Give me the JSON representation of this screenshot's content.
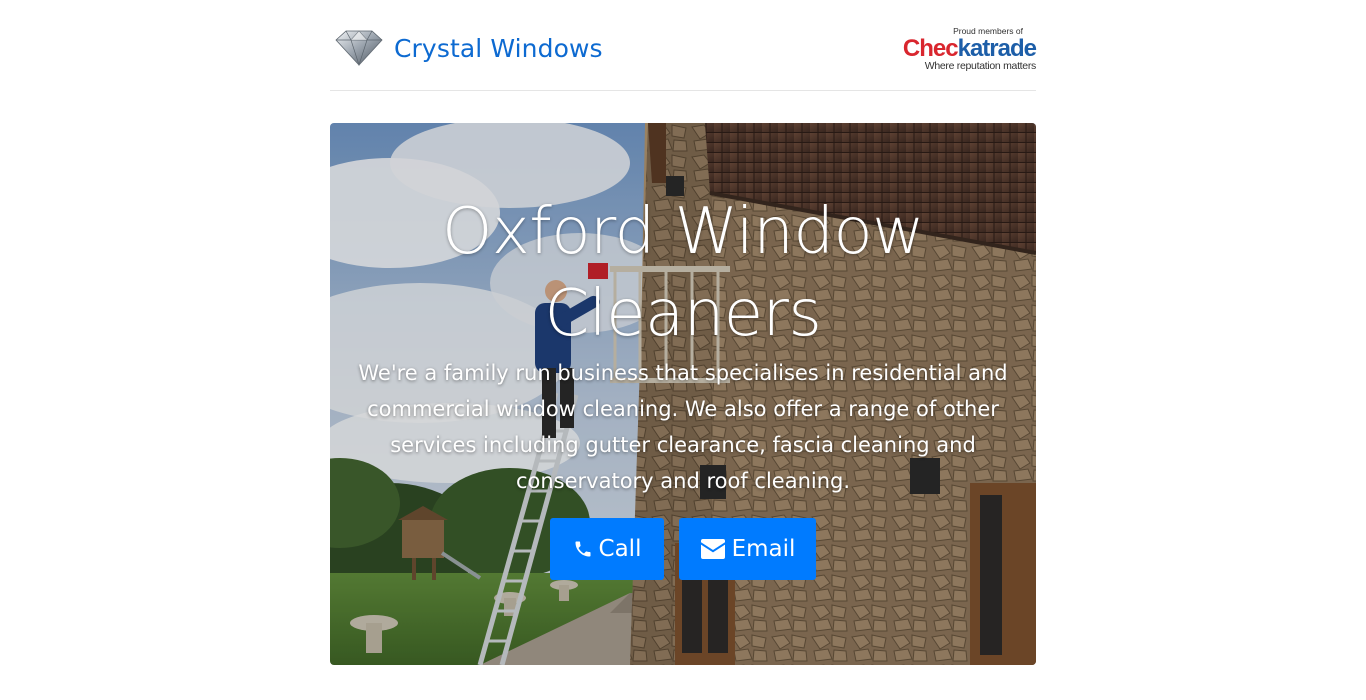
{
  "header": {
    "brand_name": "Crystal Windows",
    "logo_icon": "diamond-icon",
    "checkatrade": {
      "proud": "Proud members of",
      "wordmark_red": "Chec",
      "wordmark_tick": "k",
      "wordmark_blue": "atrade",
      "tagline": "Where reputation matters"
    }
  },
  "hero": {
    "title": "Oxford Window Cleaners",
    "lead": "We're a family run business that specialises in residential and commercial window cleaning. We also offer a range of other services including gutter clearance, fascia cleaning and conservatory and roof cleaning.",
    "buttons": {
      "call_label": "Call",
      "call_icon": "phone-icon",
      "email_label": "Email",
      "email_icon": "envelope-icon"
    }
  },
  "colors": {
    "brand": "#0d6ad1",
    "button": "#007bff",
    "checkatrade_red": "#d9262e",
    "checkatrade_blue": "#1d5ea8"
  }
}
